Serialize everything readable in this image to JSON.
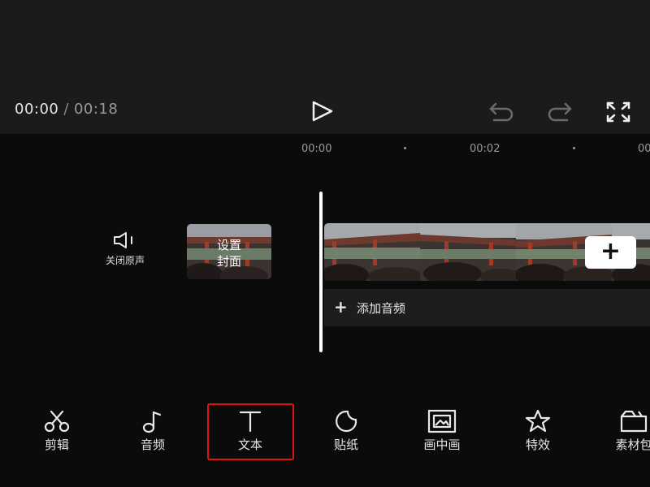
{
  "player": {
    "current_time": "00:00",
    "separator": "/",
    "total_time": "00:18"
  },
  "ruler": {
    "marks": [
      "00:00",
      "00:02",
      "00"
    ]
  },
  "track": {
    "mute_label": "关闭原声",
    "cover_label_line1": "设置",
    "cover_label_line2": "封面",
    "add_clip_symbol": "+",
    "add_audio_symbol": "+",
    "add_audio_label": "添加音频"
  },
  "toolbar": {
    "items": [
      {
        "label": "剪辑",
        "icon": "scissors-icon"
      },
      {
        "label": "音频",
        "icon": "music-note-icon"
      },
      {
        "label": "文本",
        "icon": "text-icon",
        "selected": true
      },
      {
        "label": "贴纸",
        "icon": "sticker-icon"
      },
      {
        "label": "画中画",
        "icon": "picture-in-picture-icon"
      },
      {
        "label": "特效",
        "icon": "star-effect-icon"
      },
      {
        "label": "素材包",
        "icon": "material-pack-icon"
      }
    ]
  },
  "colors": {
    "highlight": "#e01414",
    "background": "#0b0b0b",
    "preview": "#1b1b1b"
  }
}
